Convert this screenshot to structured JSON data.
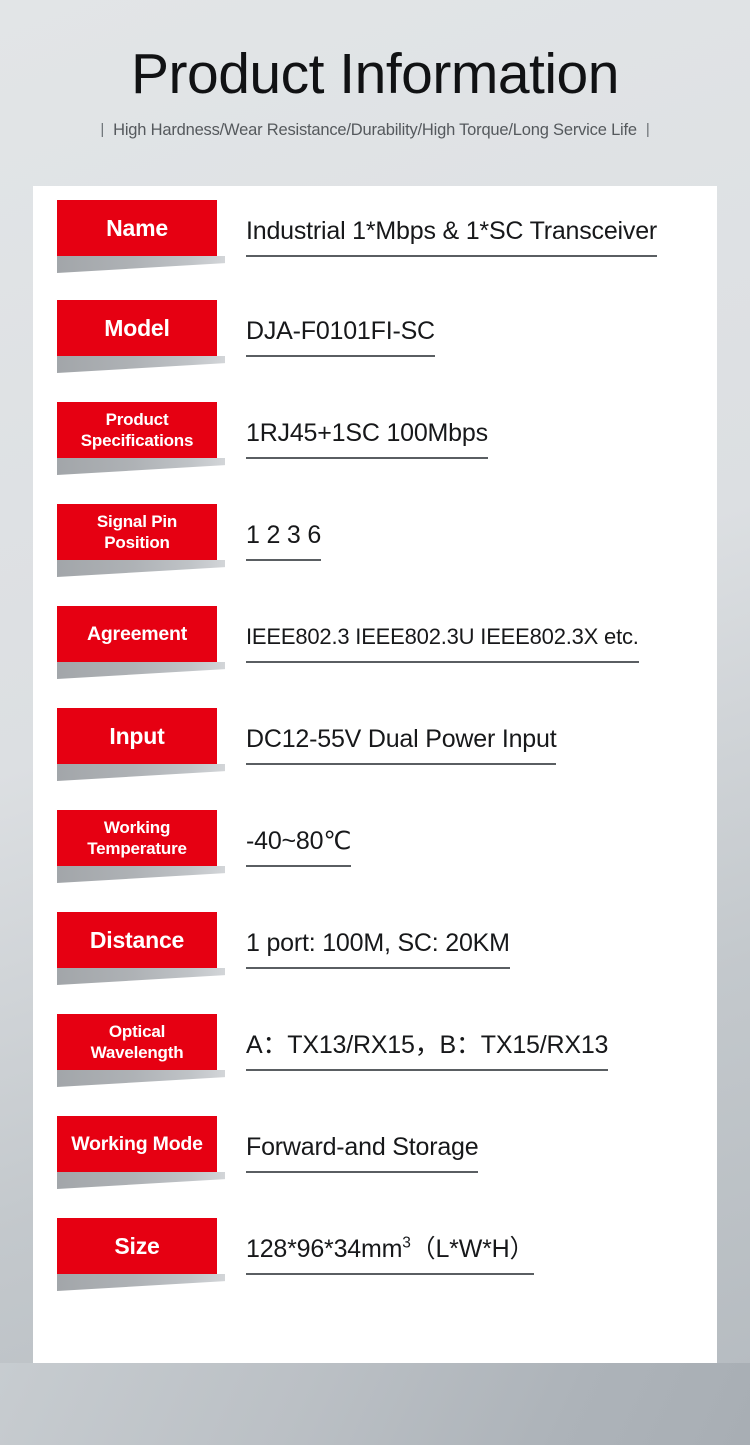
{
  "header": {
    "title": "Product Information",
    "subtitle": "High Hardness/Wear Resistance/Durability/High Torque/Long Service Life",
    "bar_left": "|",
    "bar_right": "|"
  },
  "colors": {
    "tag_red": "#e60012",
    "page_background": "#dcdfe2",
    "card_background": "#ffffff",
    "underline": "#5a5e62",
    "text": "#17181a"
  },
  "spec_rows": [
    {
      "label": "Name",
      "value": "Industrial 1*Mbps & 1*SC Transceiver"
    },
    {
      "label": "Model",
      "value": "DJA-F0101FI-SC"
    },
    {
      "label": "Product Specifications",
      "label_line1": "Product",
      "label_line2": "Specifications",
      "value": "1RJ45+1SC  100Mbps"
    },
    {
      "label": "Signal Pin Position",
      "label_line1": "Signal Pin",
      "label_line2": "Position",
      "value": "1 2 3 6"
    },
    {
      "label": "Agreement",
      "value": "IEEE802.3   IEEE802.3U   IEEE802.3X etc."
    },
    {
      "label": "Input",
      "value": "DC12-55V Dual Power Input"
    },
    {
      "label": "Working Temperature",
      "label_line1": "Working",
      "label_line2": "Temperature",
      "value": "-40~80℃"
    },
    {
      "label": "Distance",
      "value": "1 port: 100M,  SC: 20KM"
    },
    {
      "label": "Optical Wavelength",
      "label_line1": "Optical",
      "label_line2": "Wavelength",
      "value": "A：TX13/RX15，B：TX15/RX13"
    },
    {
      "label": "Working Mode",
      "value": "Forward-and Storage"
    },
    {
      "label": "Size",
      "value": "128*96*34mm³ （L*W*H）",
      "value_base": "128*96*34mm",
      "value_sup": "3",
      "value_tail": "（L*W*H）"
    }
  ]
}
